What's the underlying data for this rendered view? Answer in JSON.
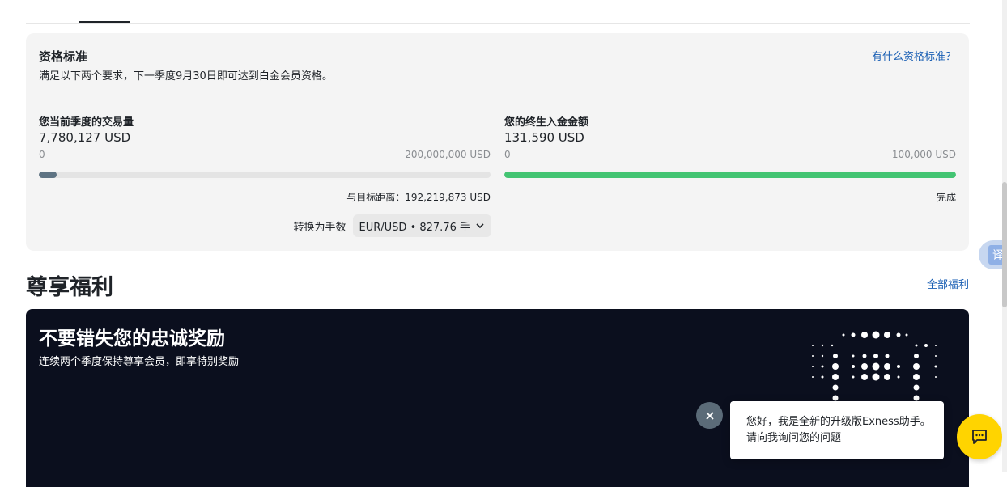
{
  "qualification": {
    "title": "资格标准",
    "subtitle": "满足以下两个要求，下一季度9月30日即可达到白金会员资格。",
    "help_link": "有什么资格标准？",
    "volume": {
      "label": "您当前季度的交易量",
      "value": "7,780,127 USD",
      "min": "0",
      "max": "200,000,000 USD",
      "progress": 0.039,
      "color": "#5e7383",
      "note": "与目标距离：192,219,873 USD"
    },
    "deposit": {
      "label": "您的终生入金金额",
      "value": "131,590 USD",
      "min": "0",
      "max": "100,000 USD",
      "progress": 1.0,
      "color": "#43c472",
      "note": "完成"
    },
    "convert_label": "转换为手数",
    "convert_value": "EUR/USD • 827.76 手"
  },
  "benefits": {
    "title": "尊享福利",
    "all_link": "全部福利",
    "banner_title": "不要错失您的忠诚奖励",
    "banner_subtitle": "连续两个季度保持尊享会员，即享特别奖励"
  },
  "chat": {
    "message": "您好，我是全新的升级版Exness助手。请向我询问您的问题"
  },
  "translate_label": "译"
}
